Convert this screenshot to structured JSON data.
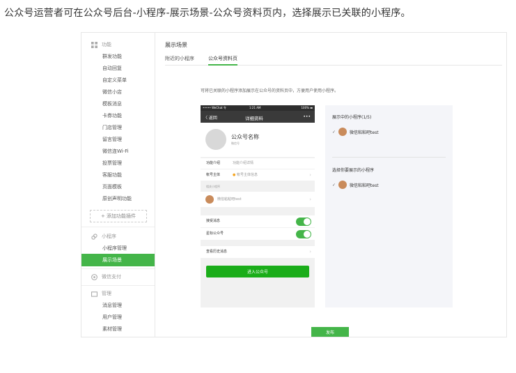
{
  "caption": "公众号运营者可在公众号后台-小程序-展示场景-公众号资料页内，选择展示已关联的小程序。",
  "sidebar": {
    "feature_title": "功能",
    "feature_items": [
      "群发功能",
      "自动回复",
      "自定义菜单",
      "微信小店",
      "模板消息",
      "卡券功能",
      "门店管理",
      "留言管理",
      "微信连Wi-Fi",
      "投票管理",
      "客服功能",
      "页面模板",
      "原创声明功能"
    ],
    "add_plugin": "+ 添加功能插件",
    "mini_title": "小程序",
    "mini_items": [
      "小程序管理",
      "展示场景"
    ],
    "pay_title": "微信支付",
    "manage_title": "管理",
    "manage_items": [
      "消息管理",
      "用户管理",
      "素材管理"
    ]
  },
  "main": {
    "title": "展示场景",
    "tabs": [
      "附近的小程序",
      "公众号资料页"
    ],
    "description": "可将已关联的小程序添加展示在公众号的资料页中，方便用户使用小程序。",
    "publish": "发布"
  },
  "phone": {
    "status_left": "••••• WeChat 令",
    "status_time": "1:21 AM",
    "status_right": "100% ▬",
    "back": "〈 返回",
    "nav_title": "详细资料",
    "nav_more": "•••",
    "account_name": "公众号名称",
    "account_id": "微信号",
    "intro_label": "功能介绍",
    "intro_value": "功能介绍详情",
    "subject_label": "帐号主体",
    "subject_value": "帐号主体信息",
    "mini_section": "相关小程序",
    "mini_name": "微信粘粘吧test",
    "receive_msg": "接受消息",
    "star_account": "星标公众号",
    "history": "查看历史消息",
    "enter_button": "进入公众号"
  },
  "panel": {
    "showing_title": "展示中的小程序(1/5)",
    "showing_item": "微信粘粘吧test",
    "select_title": "选择你要展示的小程序",
    "select_item": "微信粘粘吧test",
    "check": "✓"
  },
  "colors": {
    "accent": "#44b549",
    "wechat_green": "#1aad19",
    "phone_bar": "#3a3a3a"
  }
}
